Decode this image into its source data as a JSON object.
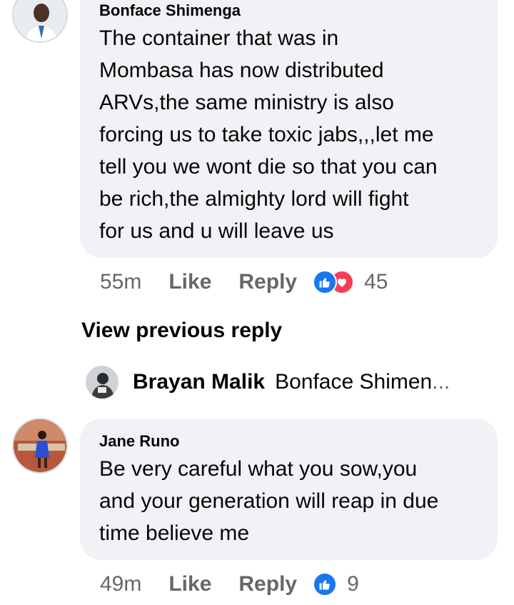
{
  "comments": [
    {
      "author": "Bonface Shimenga",
      "text": "The container that was in\nMombasa has now distributed\nARVs,the same ministry is also\nforcing us to take toxic jabs,,,let me\ntell you we wont die so that you can\nbe rich,the almighty lord will fight\nfor us and u will leave us",
      "time": "55m",
      "like_label": "Like",
      "reply_label": "Reply",
      "reactions": [
        "like-icon",
        "love-icon"
      ],
      "reaction_count": "45"
    },
    {
      "author": "Jane Runo",
      "text": "Be very careful what you sow,you\nand your generation will reap in due\ntime believe me",
      "time": "49m",
      "like_label": "Like",
      "reply_label": "Reply",
      "reactions": [
        "like-icon"
      ],
      "reaction_count": "9"
    }
  ],
  "view_previous": "View previous reply",
  "reply_preview": {
    "author": "Brayan Malik",
    "snippet": "Bonface Shimen",
    "ellipsis": "..."
  },
  "colors": {
    "bubble": "#f0f2f5",
    "like_blue": "#1877f2",
    "love_red": "#f33e58",
    "meta_gray": "#65676b"
  }
}
